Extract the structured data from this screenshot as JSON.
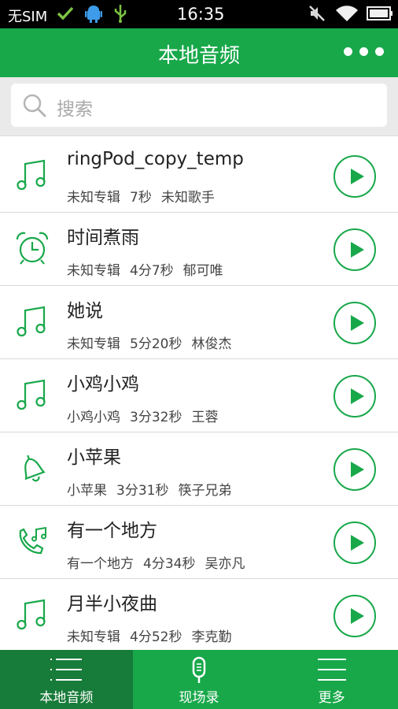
{
  "status_bar": {
    "carrier": "无SIM",
    "time": "16:35"
  },
  "header": {
    "title": "本地音频",
    "more_icon": "more-dots-icon"
  },
  "search": {
    "placeholder": "搜索",
    "icon": "search-icon"
  },
  "songs": [
    {
      "title": "ringPod_copy_temp",
      "album": "未知专辑",
      "duration": "7秒",
      "artist": "未知歌手",
      "icon": "music-note-icon"
    },
    {
      "title": "时间煮雨",
      "album": "未知专辑",
      "duration": "4分7秒",
      "artist": "郁可唯",
      "icon": "alarm-clock-icon"
    },
    {
      "title": "她说",
      "album": "未知专辑",
      "duration": "5分20秒",
      "artist": "林俊杰",
      "icon": "music-note-icon"
    },
    {
      "title": "小鸡小鸡",
      "album": "小鸡小鸡",
      "duration": "3分32秒",
      "artist": "王蓉",
      "icon": "music-note-icon"
    },
    {
      "title": "小苹果",
      "album": "小苹果",
      "duration": "3分31秒",
      "artist": "筷子兄弟",
      "icon": "bell-icon"
    },
    {
      "title": "有一个地方",
      "album": "有一个地方",
      "duration": "4分34秒",
      "artist": "吴亦凡",
      "icon": "phone-ringtone-icon"
    },
    {
      "title": "月半小夜曲",
      "album": "未知专辑",
      "duration": "4分52秒",
      "artist": "李克勤",
      "icon": "music-note-icon"
    }
  ],
  "bottom_nav": {
    "items": [
      {
        "label": "本地音频",
        "icon": "list-icon",
        "active": true
      },
      {
        "label": "现场录",
        "icon": "microphone-icon",
        "active": false
      },
      {
        "label": "更多",
        "icon": "menu-icon",
        "active": false
      }
    ]
  },
  "colors": {
    "accent": "#18a84a",
    "accent_dark": "#177b39"
  }
}
